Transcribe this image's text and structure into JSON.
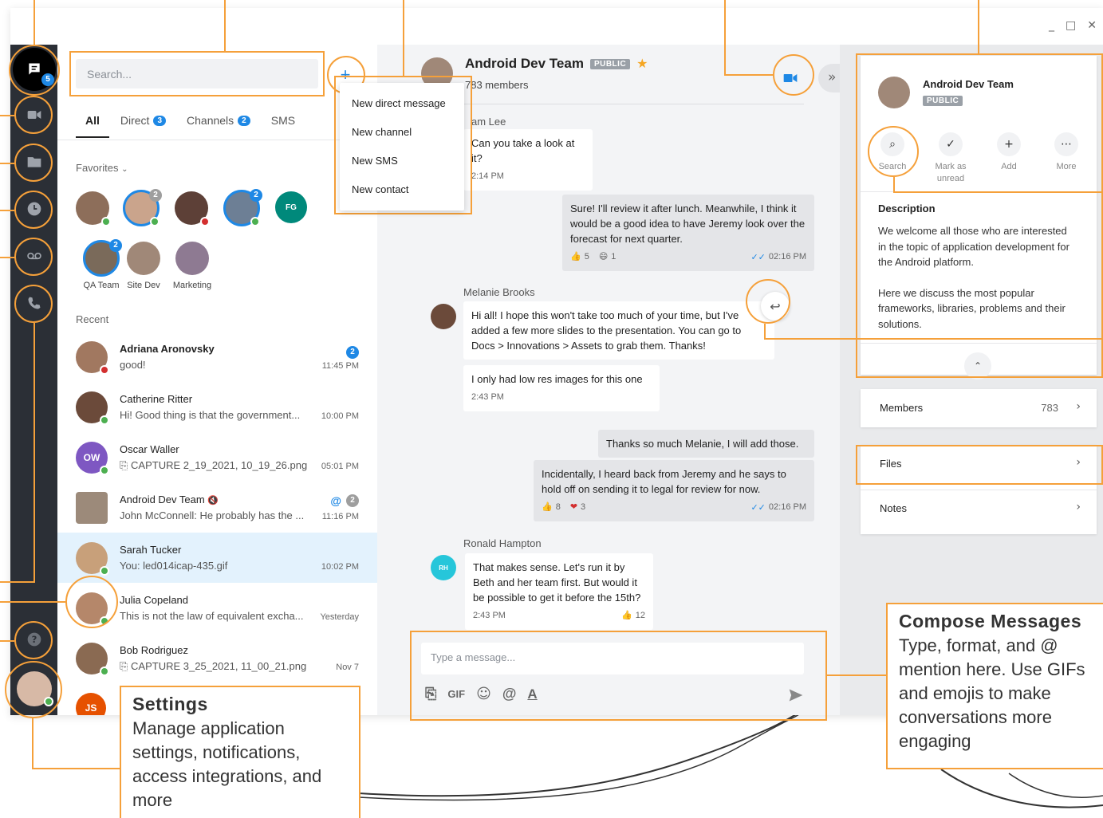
{
  "window": {
    "minimize": "_",
    "maximize": "□",
    "close": "✕"
  },
  "rail": {
    "messages_badge": "5"
  },
  "sidebar": {
    "search_placeholder": "Search...",
    "add_button": "+",
    "tabs": [
      {
        "label": "All",
        "count": ""
      },
      {
        "label": "Direct",
        "count": "3"
      },
      {
        "label": "Channels",
        "count": "2"
      },
      {
        "label": "SMS",
        "count": ""
      }
    ],
    "favorites_label": "Favorites",
    "favorites_badges": [
      "2",
      "2",
      "2"
    ],
    "fg_initials": "FG",
    "groups": [
      {
        "label": "QA Team"
      },
      {
        "label": "Site Dev"
      },
      {
        "label": "Marketing"
      }
    ],
    "recent_label": "Recent",
    "conversations": [
      {
        "name": "Adriana Aronovsky",
        "preview": "good!",
        "time": "11:45 PM",
        "badge": "2",
        "bold": true
      },
      {
        "name": "Catherine Ritter",
        "preview": "Hi! Good thing is that the government...",
        "time": "10:00 PM"
      },
      {
        "name": "Oscar Waller",
        "preview": "CAPTURE 2_19_2021, 10_19_26.png",
        "time": "05:01 PM",
        "initials": "OW"
      },
      {
        "name": "Android Dev Team",
        "preview": "John McConnell: He probably has the ...",
        "time": "11:16 PM",
        "badge": "2",
        "mention": "@"
      },
      {
        "name": "Sarah Tucker",
        "preview": "You: led014icap-435.gif",
        "time": "10:02 PM"
      },
      {
        "name": "Julia Copeland",
        "preview": "This is not the law of equivalent excha...",
        "time": "Yesterday"
      },
      {
        "name": "Bob Rodriguez",
        "preview": "CAPTURE 3_25_2021, 11_00_21.png",
        "time": "Nov 7"
      },
      {
        "initials": "JS"
      }
    ]
  },
  "menu": {
    "items": [
      "New direct message",
      "New channel",
      "New SMS",
      "New contact"
    ]
  },
  "chat": {
    "title": "Android Dev Team",
    "tag": "PUBLIC",
    "members": "783 members",
    "messages": [
      {
        "sender": "am Lee",
        "text": "Can you take a look at it?",
        "time": "2:14 PM"
      },
      {
        "text": "Sure! I'll review it after lunch. Meanwhile, I think it would be a good idea to have Jeremy look over the forecast for next quarter.",
        "reactions": [
          {
            "emoji": "👍",
            "count": "5"
          },
          {
            "emoji": "😄",
            "count": "1"
          }
        ],
        "time": "02:16 PM"
      },
      {
        "sender": "Melanie Brooks",
        "text": "Hi all! I hope this won't take too much of your time, but I've added a few more slides to the presentation. You can go to Docs > Innovations > Assets to grab them. Thanks!"
      },
      {
        "text": "I only had low res images for this one",
        "time": "2:43 PM"
      },
      {
        "text": "Thanks so much Melanie, I will add those."
      },
      {
        "text": "Incidentally, I heard back from Jeremy and he says to hold off on sending it to legal for review for now.",
        "reactions": [
          {
            "emoji": "👍",
            "count": "8"
          },
          {
            "emoji": "❤",
            "count": "3"
          }
        ],
        "time": "02:16 PM"
      },
      {
        "sender": "Ronald Hampton",
        "initials": "RH",
        "text": "That makes sense. Let's run it by Beth and her team first. But would it be possible to get it before the 15th?",
        "time": "2:43 PM",
        "reactions": [
          {
            "emoji": "👍",
            "count": "12"
          }
        ]
      }
    ],
    "composer_placeholder": "Type a message...",
    "tools": {
      "gif": "GIF"
    }
  },
  "details": {
    "title": "Android Dev Team",
    "tag": "PUBLIC",
    "actions": [
      {
        "label": "Search"
      },
      {
        "label": "Mark as unread"
      },
      {
        "label": "Add"
      },
      {
        "label": "More"
      }
    ],
    "description_label": "Description",
    "description_p1": "We welcome all those who are interested in the topic of application development for the Android platform.",
    "description_p2": "Here we discuss the most popular frameworks, libraries, problems and their solutions.",
    "members_label": "Members",
    "members_count": "783",
    "files_label": "Files",
    "notes_label": "Notes"
  },
  "callouts": {
    "settings": {
      "title": "Settings",
      "desc": "Manage application settings, notifications, access integrations, and more"
    },
    "compose": {
      "title": "Compose Messages",
      "desc": "Type, format, and @ mention here. Use GIFs and emojis to make conversations more engaging"
    }
  },
  "colors": {
    "accent": "#1e88e5",
    "callout": "#f5a03a",
    "rail": "#2b2f36",
    "online": "#4caf50"
  }
}
